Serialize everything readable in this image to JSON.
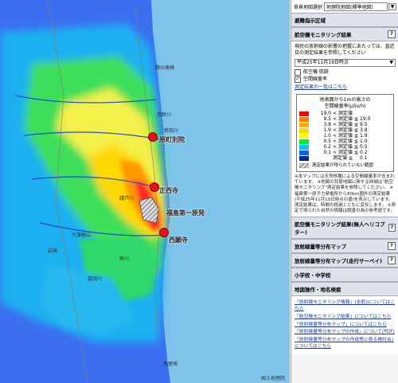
{
  "map": {
    "places": {
      "odaka": "原町別院",
      "futaba": "正西寺",
      "npp": "福島第一原発",
      "okuma": "西願寺"
    },
    "small_labels": {
      "nibetake": "鶴の尾崎",
      "mano": "真野川",
      "niida": "新田川",
      "ukedo": "請戸川",
      "kuma": "熊川",
      "tomioka": "富岡川",
      "okawa": "大滝根山",
      "iwaki": "岩崎",
      "torinoko": "鳥屋崎"
    },
    "attribution": "国土地理院"
  },
  "panel": {
    "background_label": "背景地図選択",
    "background_value": "地理院地図(標準地図)",
    "evacuation_header": "避難指示区域",
    "aerial_header": "航空機モニタリング結果",
    "aerial_intro": "現状の放射線の影響の把握にあたっては、直近日の測定結果を参照してください",
    "date_value": "平成25年11月19日時点",
    "check1": "航空機 航跡",
    "check2": "空間線量率",
    "link_list": "測定結果の一覧はこちら",
    "legend_title1": "地表面から1mの高さの",
    "legend_title2": "空間線量率(μSv/h)",
    "legend": [
      {
        "color": "#ff0000",
        "val": "19.0",
        "op": "< 測定値",
        "hi": ""
      },
      {
        "color": "#ff7a00",
        "val": "9.5",
        "op": "< 測定値 ≦",
        "hi": "19.0"
      },
      {
        "color": "#ffb300",
        "val": "3.8",
        "op": "< 測定値 ≦",
        "hi": "9.5"
      },
      {
        "color": "#ffd800",
        "val": "1.9",
        "op": "< 測定値 ≦",
        "hi": "3.8"
      },
      {
        "color": "#ffff00",
        "val": "1.0",
        "op": "< 測定値 ≦",
        "hi": "1.9"
      },
      {
        "color": "#00ee30",
        "val": "0.5",
        "op": "< 測定値 ≦",
        "hi": "1.0"
      },
      {
        "color": "#00c8ff",
        "val": "0.2",
        "op": "< 測定値 ≦",
        "hi": "0.5"
      },
      {
        "color": "#0064ff",
        "val": "0.1",
        "op": "< 測定値 ≦",
        "hi": "0.2"
      },
      {
        "color": "#00259a",
        "val": "",
        "op": "測定値 ≦",
        "hi": "0.1"
      }
    ],
    "legend_hatch": "測定結果が得られていない範囲",
    "notes": "※本マップには天然核種による空間線量率が含まれています。 ※地図の背景地図に関する詳細は\"航空機モニタリング\"測定結果を参照してください。 ※福島第一原子力発電所から80km圏外の測定結果(平成25年11月19日時点の値)を表示しています。測定結果は、時間の経過とともに変化します。 ※測定で得られた自然の情報は調査の為の参考値です。",
    "aerial_unmanned": "航空機モニタリング結果(無人ヘリコプター)",
    "dist_map": "放射線量等分布マップ",
    "dist_map_car": "放射線量等分布マップ(走行サーベイ)",
    "schools": "小学校・中学校",
    "search": "地図操作・地名検索",
    "links": [
      "「放射線モニタリング情報」(全般)についてはこちら",
      "「航空機モニタリング結果」についてはこちら",
      "「放射線量等分布マップ」についてはこちら",
      "「放射線量等分布マップの作成」について(PDF)",
      "「放射線量等分布マップの作成等に係る検討会」についてはこちら"
    ]
  }
}
